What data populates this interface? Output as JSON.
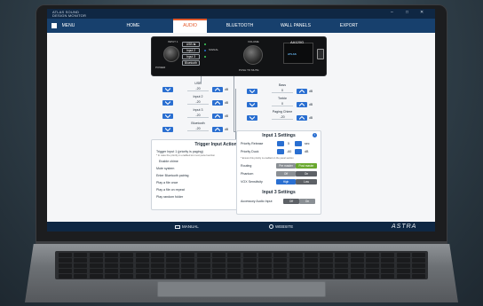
{
  "titlebar": {
    "logo_line1": "ATLAS SOUND",
    "logo_line2": "DESIGN MONITOR",
    "win_min": "–",
    "win_max": "□",
    "win_close": "✕"
  },
  "nav": {
    "menu": "MENU",
    "tabs": [
      "HOME",
      "AUDIO",
      "BLUETOOTH",
      "WALL PANELS",
      "EXPORT"
    ],
    "active": "AUDIO"
  },
  "device": {
    "input_label": "INPUT 1",
    "volume_label": "VOLUME",
    "power_label": "POWER",
    "push_mute": "PUSH TO MUTE",
    "model": "AA120G",
    "brand": "ATLAS",
    "sources": [
      "USB ⇆",
      "Input 2",
      "Input 3",
      "Bluetooth"
    ],
    "signal": "SIGNAL"
  },
  "inputs": [
    {
      "label": "USB",
      "value": "-20",
      "unit": "dB"
    },
    {
      "label": "Input 2",
      "value": "-20",
      "unit": "dB"
    },
    {
      "label": "Input 3",
      "value": "-20",
      "unit": "dB"
    },
    {
      "label": "Bluetooth",
      "value": "-20",
      "unit": "dB"
    }
  ],
  "tone": [
    {
      "label": "Bass",
      "value": "0",
      "unit": "dB"
    },
    {
      "label": "Treble",
      "value": "0",
      "unit": "dB"
    },
    {
      "label": "Paging Chime",
      "value": "-20",
      "unit": "dB"
    }
  ],
  "trigger": {
    "title": "Trigger Input Action",
    "items": [
      {
        "label": "Trigger Input 1 (priority is paging)",
        "note": "* In case the priority is enabled ion next panel section",
        "selected": true
      },
      {
        "label": "Enable chime",
        "value": "-30",
        "selected": false
      },
      {
        "label": "Mute system",
        "selected": false
      },
      {
        "label": "Enter Bluetooth pairing",
        "selected": false
      },
      {
        "label": "Play a file once",
        "selected": false
      },
      {
        "label": "Play a file on repeat",
        "selected": false
      },
      {
        "label": "Play random folder",
        "selected": false
      }
    ]
  },
  "settings": {
    "title": "Input 1 Settings",
    "priority_release_label": "Priority Release",
    "priority_release_value": "5",
    "priority_release_unit": "sec",
    "priority_duck_label": "Priority Duck",
    "priority_duck_value": "-60",
    "priority_duck_unit": "dB",
    "note": "* Ensure this priority is enabled on the panel section",
    "routing_label": "Routing",
    "routing_options": [
      "Pre master",
      "Post master"
    ],
    "phantom_label": "Phantom",
    "phantom_options": [
      "Off",
      "On"
    ],
    "vox_label": "VOX Sensitivity",
    "vox_options": [
      "High",
      "Low"
    ],
    "input3_title": "Input 3 Settings",
    "accessory_label": "Accessory Audio Input",
    "accessory_options": [
      "Off",
      "On"
    ]
  },
  "footer": {
    "manual": "MANUAL",
    "website": "WEBSITE",
    "brand": "ASTRA"
  },
  "colors": {
    "nav": "#17406d",
    "accent": "#e35a2c",
    "button": "#2a6fd1",
    "green": "#6aa82f"
  }
}
